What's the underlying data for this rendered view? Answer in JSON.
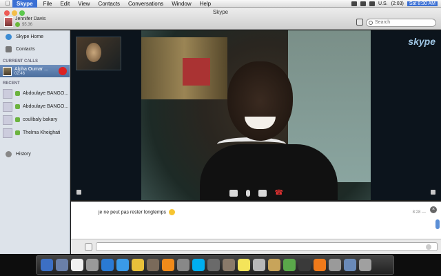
{
  "menubar": {
    "app": "Skype",
    "menus": [
      "File",
      "Edit",
      "View",
      "Contacts",
      "Conversations",
      "Window",
      "Help"
    ],
    "locale": "U.S.",
    "battery": "(2:03)",
    "clock": "Sat 8:30 AM"
  },
  "window": {
    "title": "Skype",
    "user_name": "Jennifer Davis",
    "user_balance": "$5.36",
    "search_placeholder": "Search"
  },
  "sidebar": {
    "nav": [
      {
        "label": "Skype Home",
        "icon": "skype-home-icon"
      },
      {
        "label": "Contacts",
        "icon": "contacts-icon"
      }
    ],
    "current_calls_label": "CURRENT CALLS",
    "current_call": {
      "name": "Alpha Oumar ...",
      "time": "02:46"
    },
    "recent_label": "RECENT",
    "recent": [
      {
        "label": "Abdoulaye BANGO..."
      },
      {
        "label": "Abdoulaye BANGO..."
      },
      {
        "label": "coulibaly bakary"
      },
      {
        "label": "Thelma Kheighati"
      }
    ],
    "history_label": "History"
  },
  "video": {
    "brand": "skype"
  },
  "chat": {
    "message": "je ne peut pas rester longtemps",
    "message_time": "8:28 —"
  },
  "colors": {
    "active_call": "#4c6f9e",
    "hangup": "#dd2222",
    "menubar_accent": "#3a6fd4"
  }
}
